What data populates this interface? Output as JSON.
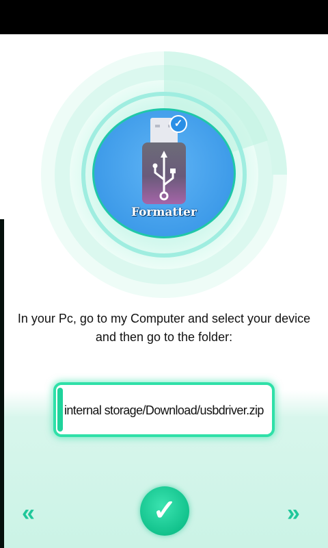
{
  "app": {
    "brand_label": "Formatter",
    "accent_color": "#1fd39b",
    "logo_color": "#3e9be9"
  },
  "main": {
    "instructions": "In your Pc, go to my Computer and select your device and then go to the folder:",
    "path_value": "internal storage/Download/usbdriver.zip"
  },
  "nav": {
    "prev_icon": "«",
    "next_icon": "»",
    "confirm_icon": "✓",
    "badge_icon": "✓"
  }
}
